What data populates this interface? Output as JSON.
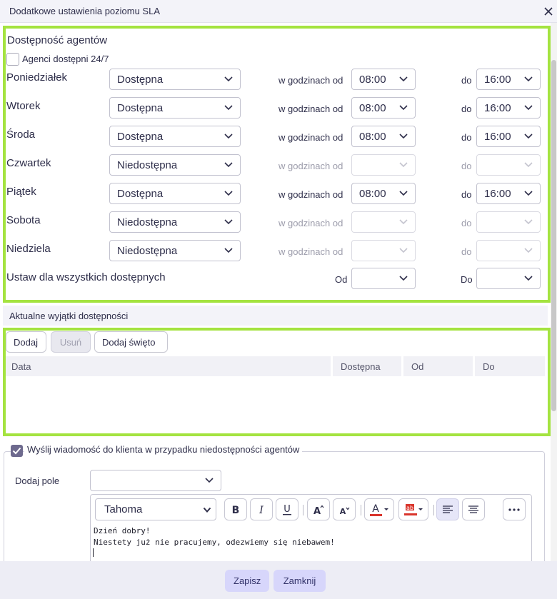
{
  "dialog": {
    "title": "Dodatkowe ustawienia poziomu SLA"
  },
  "availability": {
    "title": "Dostępność agentów",
    "always_label": "Agenci dostępni 24/7",
    "from_prefix": "w godzinach od",
    "to_prefix": "do",
    "days": [
      {
        "name": "Poniedziałek",
        "status": "Dostępna",
        "from": "08:00",
        "to": "16:00",
        "enabled": true
      },
      {
        "name": "Wtorek",
        "status": "Dostępna",
        "from": "08:00",
        "to": "16:00",
        "enabled": true
      },
      {
        "name": "Środa",
        "status": "Dostępna",
        "from": "08:00",
        "to": "16:00",
        "enabled": true
      },
      {
        "name": "Czwartek",
        "status": "Niedostępna",
        "from": "",
        "to": "",
        "enabled": false
      },
      {
        "name": "Piątek",
        "status": "Dostępna",
        "from": "08:00",
        "to": "16:00",
        "enabled": true
      },
      {
        "name": "Sobota",
        "status": "Niedostępna",
        "from": "",
        "to": "",
        "enabled": false
      },
      {
        "name": "Niedziela",
        "status": "Niedostępna",
        "from": "",
        "to": "",
        "enabled": false
      }
    ],
    "set_all": {
      "label": "Ustaw dla wszystkich dostępnych",
      "from_label": "Od",
      "to_label": "Do"
    }
  },
  "exceptions": {
    "title": "Aktualne wyjątki dostępności",
    "buttons": {
      "add": "Dodaj",
      "remove": "Usuń",
      "add_holiday": "Dodaj święto"
    },
    "columns": [
      "Data",
      "Dostępna",
      "Od",
      "Do"
    ]
  },
  "message": {
    "checkbox_label": "Wyślij wiadomość do klienta w przypadku niedostępności agentów",
    "add_field_label": "Dodaj pole",
    "font": "Tahoma",
    "lines": [
      "Dzień dobry!",
      "Niestety już nie pracujemy, odezwiemy się niebawem!"
    ]
  },
  "footer": {
    "save": "Zapisz",
    "close": "Zamknij"
  },
  "colors": {
    "highlight": "#a4e340",
    "primary_button": "#d7d6fb",
    "checkbox_checked": "#6e6a8e"
  }
}
